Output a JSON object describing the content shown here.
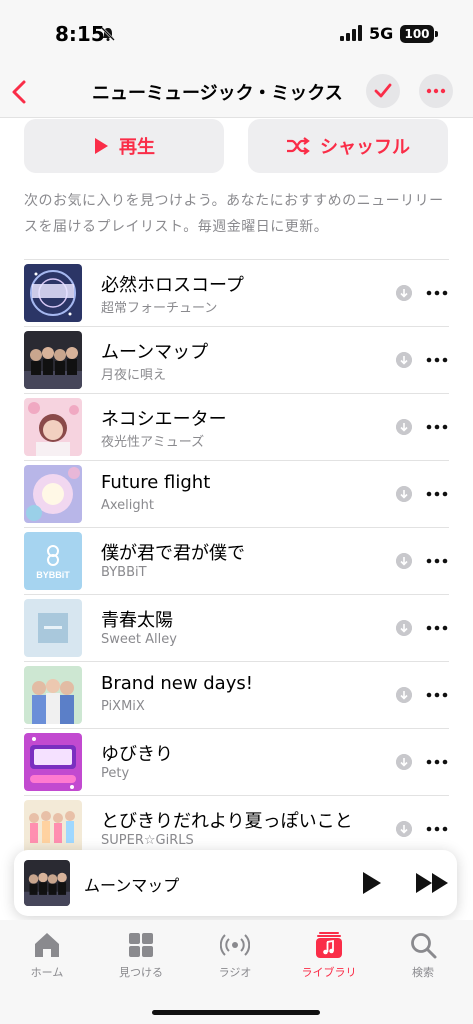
{
  "status": {
    "time": "8:15",
    "network": "5G",
    "battery": "100"
  },
  "nav": {
    "title": "ニューミュージック・ミックス"
  },
  "actions": {
    "play_label": "再生",
    "shuffle_label": "シャッフル"
  },
  "description": "次のお気に入りを見つけよう。あなたにおすすめのニューリリースを届けるプレイリスト。毎週金曜日に更新。",
  "tracks": [
    {
      "title": "必然ホロスコープ",
      "artist": "超常フォーチューン"
    },
    {
      "title": "ムーンマップ",
      "artist": "月夜に唄え"
    },
    {
      "title": "ネコシエーター",
      "artist": "夜光性アミューズ"
    },
    {
      "title": "Future flight",
      "artist": "Axelight"
    },
    {
      "title": "僕が君で君が僕で",
      "artist": "BYBBiT"
    },
    {
      "title": "青春太陽",
      "artist": "Sweet Alley"
    },
    {
      "title": "Brand new days!",
      "artist": "PiXMiX"
    },
    {
      "title": "ゆびきり",
      "artist": "Pety"
    },
    {
      "title": "とびきりだれより夏っぽいこと",
      "artist": "SUPER☆GiRLS"
    }
  ],
  "artwork": {
    "bybbit_text": "BYBBiT"
  },
  "mini_player": {
    "title": "ムーンマップ"
  },
  "tabs": [
    {
      "label": "ホーム",
      "icon": "home-icon"
    },
    {
      "label": "見つける",
      "icon": "grid-icon"
    },
    {
      "label": "ラジオ",
      "icon": "radio-icon"
    },
    {
      "label": "ライブラリ",
      "icon": "library-icon"
    },
    {
      "label": "検索",
      "icon": "search-icon"
    }
  ],
  "colors": {
    "accent": "#fa2d48",
    "secondary_text": "#8a8a8e"
  }
}
